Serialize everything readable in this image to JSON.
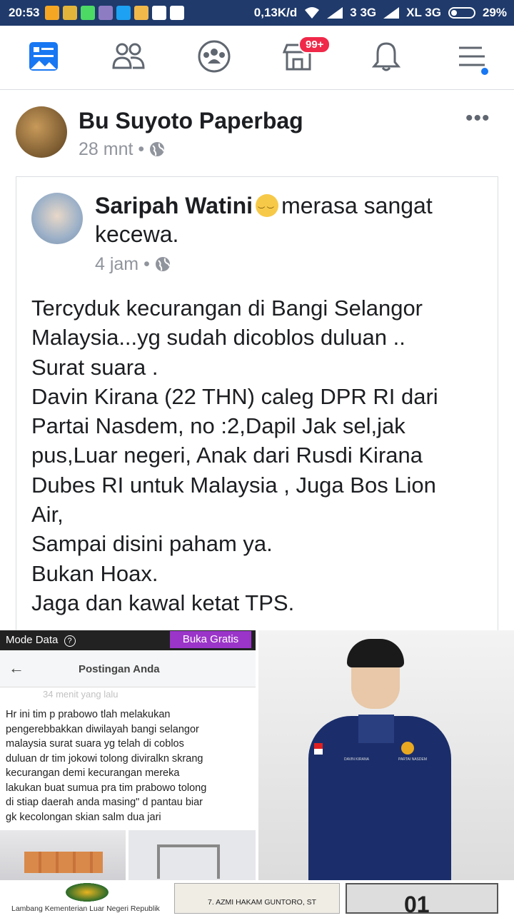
{
  "statusbar": {
    "time": "20:53",
    "speed": "0,13K/d",
    "carrier1": "3 3G",
    "carrier2": "XL 3G",
    "battery": "29%",
    "notification_icon_colors": [
      "#f5a623",
      "#e2b53a",
      "#4cd964",
      "#8e7cc3",
      "#1da1f2",
      "#f1b84a",
      "#ffffff",
      "#ffffff"
    ]
  },
  "navbar": {
    "items": [
      "news-feed",
      "friends",
      "groups",
      "marketplace",
      "notifications",
      "menu"
    ],
    "marketplace_badge": "99+",
    "active_color": "#1877f2"
  },
  "post": {
    "author": "Bu Suyoto Paperbag",
    "time": "28 mnt",
    "privacy_icon": "globe-icon",
    "more_label": "•••",
    "shared": {
      "author": "Saripah Watini",
      "feeling": "merasa sangat",
      "feeling_cont": "kecewa.",
      "emoji": "pensive-face",
      "time": "4 jam",
      "body_lines": [
        "Tercyduk kecurangan di Bangi Selangor",
        "Malaysia...yg sudah dicoblos duluan ..",
        "Surat suara .",
        "Davin Kirana (22 THN) caleg DPR RI dari",
        "Partai Nasdem, no :2,Dapil Jak sel,jak",
        "pus,Luar negeri, Anak dari Rusdi Kirana",
        "Dubes RI untuk Malaysia , Juga Bos Lion",
        "Air,",
        "Sampai disini paham ya.",
        "Bukan Hoax.",
        "Jaga dan kawal ketat TPS."
      ]
    }
  },
  "photo1": {
    "mode_label": "Mode Data",
    "info": "?",
    "free_button": "Buka Gratis",
    "header_title": "Postingan Anda",
    "faded_line": "34 menit yang lalu",
    "text_lines": [
      "Hr ini tim p prabowo tlah melakukan",
      "pengerebbakkan diwilayah bangi selangor",
      "malaysia surat suara yg telah di coblos",
      "duluan dr tim jokowi tolong diviralkn skrang",
      "kecurangan demi kecurangan mereka",
      "lakukan  buat sumua pra tim prabowo tolong",
      "di stiap daerah anda masing\" d pantau biar",
      "gk kecolongan skian salm dua jari"
    ]
  },
  "photo2": {
    "name_tag": "DAVIN KIRANA",
    "party_tag": "PARTAI NASDEM"
  },
  "bottom": {
    "b1_label": "Lambang Kementerian Luar Negeri Republik",
    "b2_label": "7.  AZMI HAKAM GUNTORO, ST",
    "b3_label": "01"
  }
}
